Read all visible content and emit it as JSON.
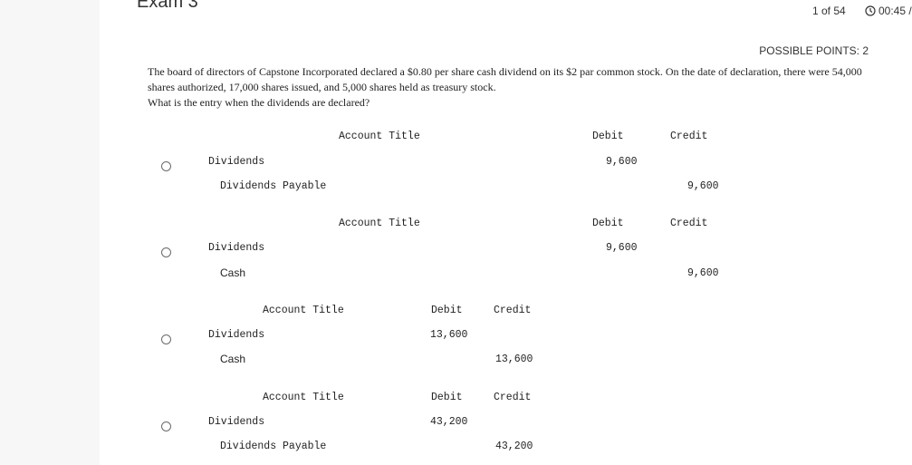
{
  "header": {
    "title": "Exam 3",
    "pager": "1 of 54",
    "timer": "00:45 /",
    "timer_icon": "clock-icon"
  },
  "points": "POSSIBLE POINTS: 2",
  "question": {
    "text1": "The board of directors of Capstone Incorporated declared a $0.80 per share cash dividend on its $2 par common stock. On the date of declaration, there were 54,000 shares authorized, 17,000 shares issued, and 5,000 shares held as treasury stock.",
    "text2": "What is the entry when the dividends are declared?"
  },
  "options": [
    {
      "header": {
        "account": "Account Title",
        "debit": "Debit",
        "credit": "Credit"
      },
      "debit_account": "Dividends",
      "debit_amount": "9,600",
      "credit_account": "Dividends Payable",
      "credit_amount": "9,600"
    },
    {
      "header": {
        "account": "Account Title",
        "debit": "Debit",
        "credit": "Credit"
      },
      "debit_account": "Dividends",
      "debit_amount": "9,600",
      "credit_account": "Cash",
      "credit_amount": "9,600"
    },
    {
      "header": {
        "account": "Account Title",
        "debit": "Debit",
        "credit": "Credit"
      },
      "debit_account": "Dividends",
      "debit_amount": "13,600",
      "credit_account": "Cash",
      "credit_amount": "13,600"
    },
    {
      "header": {
        "account": "Account Title",
        "debit": "Debit",
        "credit": "Credit"
      },
      "debit_account": "Dividends",
      "debit_amount": "43,200",
      "credit_account": "Dividends Payable",
      "credit_amount": "43,200"
    }
  ]
}
